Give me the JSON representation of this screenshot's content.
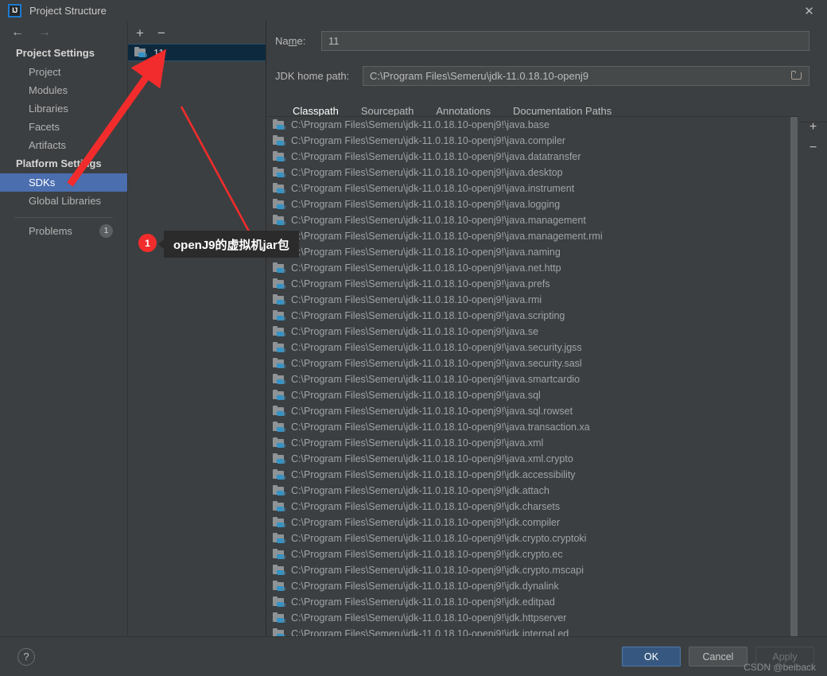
{
  "window": {
    "title": "Project Structure",
    "app_icon": "IJ",
    "close_icon": "✕"
  },
  "nav": {
    "back_icon": "←",
    "forward_icon": "→"
  },
  "sidebar": {
    "project_settings_header": "Project Settings",
    "project_items": [
      {
        "label": "Project"
      },
      {
        "label": "Modules"
      },
      {
        "label": "Libraries"
      },
      {
        "label": "Facets"
      },
      {
        "label": "Artifacts"
      }
    ],
    "platform_settings_header": "Platform Settings",
    "platform_items": [
      {
        "label": "SDKs",
        "selected": true
      },
      {
        "label": "Global Libraries",
        "selected": false
      }
    ],
    "problems_label": "Problems",
    "problems_count": "1"
  },
  "sdk_panel": {
    "add_icon": "+",
    "remove_icon": "−",
    "items": [
      {
        "label": "11",
        "selected": true
      }
    ]
  },
  "detail": {
    "name_label_pre": "Na",
    "name_label_mid": "m",
    "name_label_post": "e:",
    "name_value": "11",
    "jdk_home_label": "JDK home path:",
    "jdk_home_value": "C:\\Program Files\\Semeru\\jdk-11.0.18.10-openj9",
    "browse_icon": "folder-browse-icon",
    "tabs": [
      {
        "label": "Classpath",
        "active": true
      },
      {
        "label": "Sourcepath",
        "active": false
      },
      {
        "label": "Annotations",
        "active": false
      },
      {
        "label": "Documentation Paths",
        "active": false
      }
    ],
    "list_add_icon": "+",
    "list_remove_icon": "−",
    "classpath_prefix": "C:\\Program Files\\Semeru\\jdk-11.0.18.10-openj9!\\",
    "classpath_entries": [
      "C:\\Program Files\\Semeru\\jdk-11.0.18.10-openj9!\\java.base",
      "C:\\Program Files\\Semeru\\jdk-11.0.18.10-openj9!\\java.compiler",
      "C:\\Program Files\\Semeru\\jdk-11.0.18.10-openj9!\\java.datatransfer",
      "C:\\Program Files\\Semeru\\jdk-11.0.18.10-openj9!\\java.desktop",
      "C:\\Program Files\\Semeru\\jdk-11.0.18.10-openj9!\\java.instrument",
      "C:\\Program Files\\Semeru\\jdk-11.0.18.10-openj9!\\java.logging",
      "C:\\Program Files\\Semeru\\jdk-11.0.18.10-openj9!\\java.management",
      "C:\\Program Files\\Semeru\\jdk-11.0.18.10-openj9!\\java.management.rmi",
      "C:\\Program Files\\Semeru\\jdk-11.0.18.10-openj9!\\java.naming",
      "C:\\Program Files\\Semeru\\jdk-11.0.18.10-openj9!\\java.net.http",
      "C:\\Program Files\\Semeru\\jdk-11.0.18.10-openj9!\\java.prefs",
      "C:\\Program Files\\Semeru\\jdk-11.0.18.10-openj9!\\java.rmi",
      "C:\\Program Files\\Semeru\\jdk-11.0.18.10-openj9!\\java.scripting",
      "C:\\Program Files\\Semeru\\jdk-11.0.18.10-openj9!\\java.se",
      "C:\\Program Files\\Semeru\\jdk-11.0.18.10-openj9!\\java.security.jgss",
      "C:\\Program Files\\Semeru\\jdk-11.0.18.10-openj9!\\java.security.sasl",
      "C:\\Program Files\\Semeru\\jdk-11.0.18.10-openj9!\\java.smartcardio",
      "C:\\Program Files\\Semeru\\jdk-11.0.18.10-openj9!\\java.sql",
      "C:\\Program Files\\Semeru\\jdk-11.0.18.10-openj9!\\java.sql.rowset",
      "C:\\Program Files\\Semeru\\jdk-11.0.18.10-openj9!\\java.transaction.xa",
      "C:\\Program Files\\Semeru\\jdk-11.0.18.10-openj9!\\java.xml",
      "C:\\Program Files\\Semeru\\jdk-11.0.18.10-openj9!\\java.xml.crypto",
      "C:\\Program Files\\Semeru\\jdk-11.0.18.10-openj9!\\jdk.accessibility",
      "C:\\Program Files\\Semeru\\jdk-11.0.18.10-openj9!\\jdk.attach",
      "C:\\Program Files\\Semeru\\jdk-11.0.18.10-openj9!\\jdk.charsets",
      "C:\\Program Files\\Semeru\\jdk-11.0.18.10-openj9!\\jdk.compiler",
      "C:\\Program Files\\Semeru\\jdk-11.0.18.10-openj9!\\jdk.crypto.cryptoki",
      "C:\\Program Files\\Semeru\\jdk-11.0.18.10-openj9!\\jdk.crypto.ec",
      "C:\\Program Files\\Semeru\\jdk-11.0.18.10-openj9!\\jdk.crypto.mscapi",
      "C:\\Program Files\\Semeru\\jdk-11.0.18.10-openj9!\\jdk.dynalink",
      "C:\\Program Files\\Semeru\\jdk-11.0.18.10-openj9!\\jdk.editpad",
      "C:\\Program Files\\Semeru\\jdk-11.0.18.10-openj9!\\jdk.httpserver",
      "C:\\Program Files\\Semeru\\jdk-11.0.18.10-openj9!\\jdk.internal.ed"
    ]
  },
  "footer": {
    "help_icon": "?",
    "ok_label": "OK",
    "cancel_label": "Cancel",
    "apply_label": "Apply",
    "watermark": "CSDN @beiback"
  },
  "annotation": {
    "badge_number": "1",
    "callout_text": "openJ9的虚拟机jar包",
    "arrow_color": "#f22c2c"
  }
}
